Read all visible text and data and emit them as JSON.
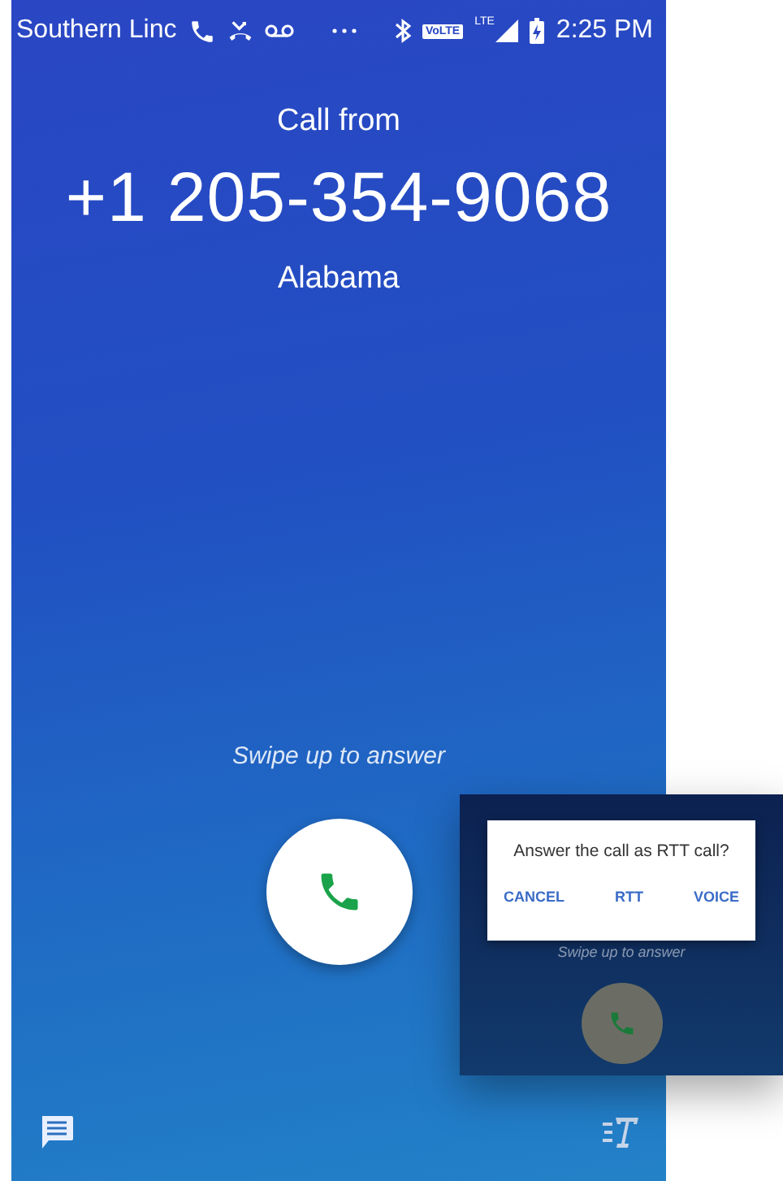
{
  "status_bar": {
    "carrier": "Southern Linc",
    "volte": "VoLTE",
    "network": "LTE",
    "time": "2:25 PM"
  },
  "call": {
    "label": "Call from",
    "number": "+1 205-354-9068",
    "location": "Alabama"
  },
  "answer": {
    "hint": "Swipe up to answer"
  },
  "rtt_inset": {
    "message": "Answer the call as RTT call?",
    "buttons": [
      "CANCEL",
      "RTT",
      "VOICE"
    ],
    "hint": "Swipe up to answer"
  }
}
